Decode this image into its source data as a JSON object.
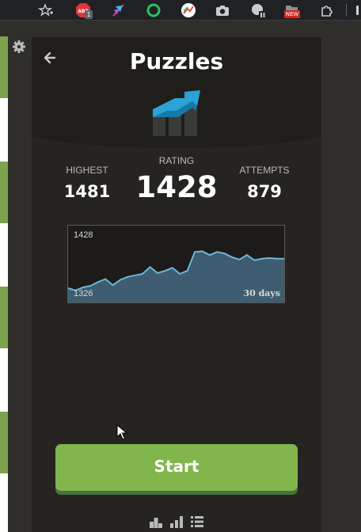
{
  "toolbar": {
    "icons": [
      "add-to-favorites-icon",
      "adblock-extension-icon",
      "feather-extension-icon",
      "green-ring-extension-icon",
      "chart-extension-icon",
      "camera-extension-icon",
      "picture-in-picture-extension-icon",
      "folder-new-extension-icon",
      "extensions-puzzle-icon"
    ],
    "abp_badge": "1",
    "new_badge": "NEW"
  },
  "panel": {
    "title": "Puzzles",
    "stats": {
      "highest_label": "HIGHEST",
      "highest_value": "1481",
      "rating_label": "RATING",
      "rating_value": "1428",
      "attempts_label": "ATTEMPTS",
      "attempts_value": "879"
    },
    "graph": {
      "top_label": "1428",
      "bottom_label": "1326",
      "period_label": "30 days",
      "series": [
        1345,
        1342,
        1346,
        1348,
        1353,
        1357,
        1349,
        1356,
        1360,
        1362,
        1364,
        1373,
        1365,
        1368,
        1372,
        1364,
        1368,
        1393,
        1394,
        1389,
        1393,
        1391,
        1386,
        1383,
        1389,
        1382,
        1384,
        1385,
        1384,
        1384
      ]
    },
    "start_label": "Start",
    "bottom_icons": [
      "leaderboard-icon",
      "stats-icon",
      "history-list-icon"
    ]
  },
  "colors": {
    "accent_green": "#81b64c",
    "panel_bg": "#262421",
    "graph_fill": "#3e5d70",
    "graph_line": "#6cb6da"
  }
}
